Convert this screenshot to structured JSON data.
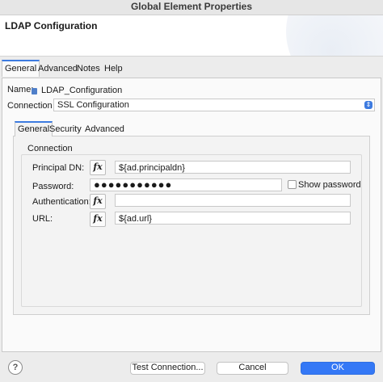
{
  "window": {
    "title": "Global Element Properties"
  },
  "header": {
    "title": "LDAP Configuration"
  },
  "tabs": [
    "General",
    "Advanced",
    "Notes",
    "Help"
  ],
  "form": {
    "name_label": "Name:",
    "name_value": "LDAP_Configuration",
    "connection_label": "Connection",
    "connection_value": "SSL Configuration"
  },
  "inner_tabs": [
    "General",
    "Security",
    "Advanced"
  ],
  "group_title": "Connection",
  "fields": {
    "principal_label": "Principal DN:",
    "principal_value": "${ad.principaldn}",
    "password_label": "Password:",
    "password_value": "●●●●●●●●●●●",
    "show_password_label": "Show password",
    "authentication_label": "Authentication:",
    "authentication_value": "",
    "url_label": "URL:",
    "url_value": "${ad.url}",
    "fx_label": "fx"
  },
  "footer": {
    "help_label": "?",
    "test_connection_label": "Test Connection...",
    "cancel_label": "Cancel",
    "ok_label": "OK"
  },
  "colors": {
    "accent": "#3478f6",
    "tab_indicator": "#3d7be0"
  }
}
